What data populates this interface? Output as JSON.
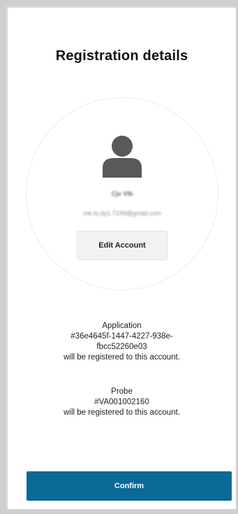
{
  "header": {
    "title": "Registration details"
  },
  "account": {
    "name": "Cjv Vlb",
    "email": "me.lo.dy1.7199@gmail.com",
    "edit_label": "Edit Account"
  },
  "application": {
    "label": "Application",
    "id_part1": "#36e4645f-1447-4227-938e-",
    "id_part2": "fbcc52260e03",
    "note": "will be registered to this account."
  },
  "probe": {
    "label": "Probe",
    "id": "#VA001002160",
    "note": "will be registered to this account."
  },
  "footer": {
    "confirm_label": "Confirm"
  },
  "colors": {
    "accent": "#0a6a98",
    "avatar": "#595959"
  },
  "icons": {
    "avatar": "user-avatar-icon"
  }
}
